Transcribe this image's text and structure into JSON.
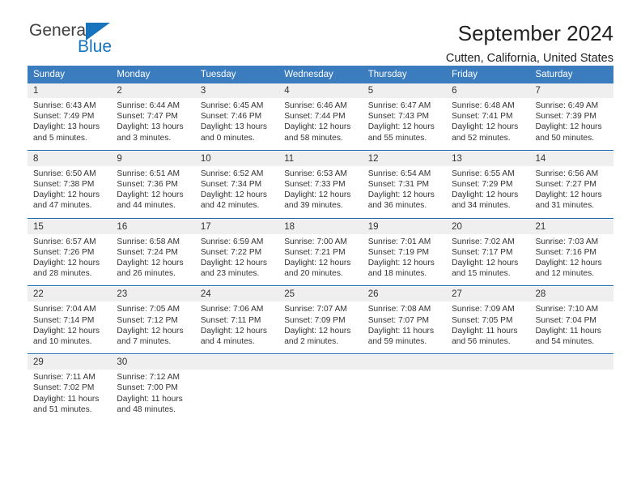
{
  "brand": {
    "line1": "General",
    "line2": "Blue",
    "triangle_color": "#1673bd"
  },
  "header": {
    "title": "September 2024",
    "subtitle": "Cutten, California, United States"
  },
  "theme": {
    "header_blue": "#3b7cbf",
    "rule_blue": "#1f6bb0",
    "daynum_gray": "#efefef"
  },
  "calendar": {
    "weekday_headers": [
      "Sunday",
      "Monday",
      "Tuesday",
      "Wednesday",
      "Thursday",
      "Friday",
      "Saturday"
    ],
    "weeks": [
      [
        {
          "day": "1",
          "sunrise": "Sunrise: 6:43 AM",
          "sunset": "Sunset: 7:49 PM",
          "daylight1": "Daylight: 13 hours",
          "daylight2": "and 5 minutes."
        },
        {
          "day": "2",
          "sunrise": "Sunrise: 6:44 AM",
          "sunset": "Sunset: 7:47 PM",
          "daylight1": "Daylight: 13 hours",
          "daylight2": "and 3 minutes."
        },
        {
          "day": "3",
          "sunrise": "Sunrise: 6:45 AM",
          "sunset": "Sunset: 7:46 PM",
          "daylight1": "Daylight: 13 hours",
          "daylight2": "and 0 minutes."
        },
        {
          "day": "4",
          "sunrise": "Sunrise: 6:46 AM",
          "sunset": "Sunset: 7:44 PM",
          "daylight1": "Daylight: 12 hours",
          "daylight2": "and 58 minutes."
        },
        {
          "day": "5",
          "sunrise": "Sunrise: 6:47 AM",
          "sunset": "Sunset: 7:43 PM",
          "daylight1": "Daylight: 12 hours",
          "daylight2": "and 55 minutes."
        },
        {
          "day": "6",
          "sunrise": "Sunrise: 6:48 AM",
          "sunset": "Sunset: 7:41 PM",
          "daylight1": "Daylight: 12 hours",
          "daylight2": "and 52 minutes."
        },
        {
          "day": "7",
          "sunrise": "Sunrise: 6:49 AM",
          "sunset": "Sunset: 7:39 PM",
          "daylight1": "Daylight: 12 hours",
          "daylight2": "and 50 minutes."
        }
      ],
      [
        {
          "day": "8",
          "sunrise": "Sunrise: 6:50 AM",
          "sunset": "Sunset: 7:38 PM",
          "daylight1": "Daylight: 12 hours",
          "daylight2": "and 47 minutes."
        },
        {
          "day": "9",
          "sunrise": "Sunrise: 6:51 AM",
          "sunset": "Sunset: 7:36 PM",
          "daylight1": "Daylight: 12 hours",
          "daylight2": "and 44 minutes."
        },
        {
          "day": "10",
          "sunrise": "Sunrise: 6:52 AM",
          "sunset": "Sunset: 7:34 PM",
          "daylight1": "Daylight: 12 hours",
          "daylight2": "and 42 minutes."
        },
        {
          "day": "11",
          "sunrise": "Sunrise: 6:53 AM",
          "sunset": "Sunset: 7:33 PM",
          "daylight1": "Daylight: 12 hours",
          "daylight2": "and 39 minutes."
        },
        {
          "day": "12",
          "sunrise": "Sunrise: 6:54 AM",
          "sunset": "Sunset: 7:31 PM",
          "daylight1": "Daylight: 12 hours",
          "daylight2": "and 36 minutes."
        },
        {
          "day": "13",
          "sunrise": "Sunrise: 6:55 AM",
          "sunset": "Sunset: 7:29 PM",
          "daylight1": "Daylight: 12 hours",
          "daylight2": "and 34 minutes."
        },
        {
          "day": "14",
          "sunrise": "Sunrise: 6:56 AM",
          "sunset": "Sunset: 7:27 PM",
          "daylight1": "Daylight: 12 hours",
          "daylight2": "and 31 minutes."
        }
      ],
      [
        {
          "day": "15",
          "sunrise": "Sunrise: 6:57 AM",
          "sunset": "Sunset: 7:26 PM",
          "daylight1": "Daylight: 12 hours",
          "daylight2": "and 28 minutes."
        },
        {
          "day": "16",
          "sunrise": "Sunrise: 6:58 AM",
          "sunset": "Sunset: 7:24 PM",
          "daylight1": "Daylight: 12 hours",
          "daylight2": "and 26 minutes."
        },
        {
          "day": "17",
          "sunrise": "Sunrise: 6:59 AM",
          "sunset": "Sunset: 7:22 PM",
          "daylight1": "Daylight: 12 hours",
          "daylight2": "and 23 minutes."
        },
        {
          "day": "18",
          "sunrise": "Sunrise: 7:00 AM",
          "sunset": "Sunset: 7:21 PM",
          "daylight1": "Daylight: 12 hours",
          "daylight2": "and 20 minutes."
        },
        {
          "day": "19",
          "sunrise": "Sunrise: 7:01 AM",
          "sunset": "Sunset: 7:19 PM",
          "daylight1": "Daylight: 12 hours",
          "daylight2": "and 18 minutes."
        },
        {
          "day": "20",
          "sunrise": "Sunrise: 7:02 AM",
          "sunset": "Sunset: 7:17 PM",
          "daylight1": "Daylight: 12 hours",
          "daylight2": "and 15 minutes."
        },
        {
          "day": "21",
          "sunrise": "Sunrise: 7:03 AM",
          "sunset": "Sunset: 7:16 PM",
          "daylight1": "Daylight: 12 hours",
          "daylight2": "and 12 minutes."
        }
      ],
      [
        {
          "day": "22",
          "sunrise": "Sunrise: 7:04 AM",
          "sunset": "Sunset: 7:14 PM",
          "daylight1": "Daylight: 12 hours",
          "daylight2": "and 10 minutes."
        },
        {
          "day": "23",
          "sunrise": "Sunrise: 7:05 AM",
          "sunset": "Sunset: 7:12 PM",
          "daylight1": "Daylight: 12 hours",
          "daylight2": "and 7 minutes."
        },
        {
          "day": "24",
          "sunrise": "Sunrise: 7:06 AM",
          "sunset": "Sunset: 7:11 PM",
          "daylight1": "Daylight: 12 hours",
          "daylight2": "and 4 minutes."
        },
        {
          "day": "25",
          "sunrise": "Sunrise: 7:07 AM",
          "sunset": "Sunset: 7:09 PM",
          "daylight1": "Daylight: 12 hours",
          "daylight2": "and 2 minutes."
        },
        {
          "day": "26",
          "sunrise": "Sunrise: 7:08 AM",
          "sunset": "Sunset: 7:07 PM",
          "daylight1": "Daylight: 11 hours",
          "daylight2": "and 59 minutes."
        },
        {
          "day": "27",
          "sunrise": "Sunrise: 7:09 AM",
          "sunset": "Sunset: 7:05 PM",
          "daylight1": "Daylight: 11 hours",
          "daylight2": "and 56 minutes."
        },
        {
          "day": "28",
          "sunrise": "Sunrise: 7:10 AM",
          "sunset": "Sunset: 7:04 PM",
          "daylight1": "Daylight: 11 hours",
          "daylight2": "and 54 minutes."
        }
      ],
      [
        {
          "day": "29",
          "sunrise": "Sunrise: 7:11 AM",
          "sunset": "Sunset: 7:02 PM",
          "daylight1": "Daylight: 11 hours",
          "daylight2": "and 51 minutes."
        },
        {
          "day": "30",
          "sunrise": "Sunrise: 7:12 AM",
          "sunset": "Sunset: 7:00 PM",
          "daylight1": "Daylight: 11 hours",
          "daylight2": "and 48 minutes."
        },
        {
          "day": "",
          "sunrise": "",
          "sunset": "",
          "daylight1": "",
          "daylight2": ""
        },
        {
          "day": "",
          "sunrise": "",
          "sunset": "",
          "daylight1": "",
          "daylight2": ""
        },
        {
          "day": "",
          "sunrise": "",
          "sunset": "",
          "daylight1": "",
          "daylight2": ""
        },
        {
          "day": "",
          "sunrise": "",
          "sunset": "",
          "daylight1": "",
          "daylight2": ""
        },
        {
          "day": "",
          "sunrise": "",
          "sunset": "",
          "daylight1": "",
          "daylight2": ""
        }
      ]
    ]
  }
}
